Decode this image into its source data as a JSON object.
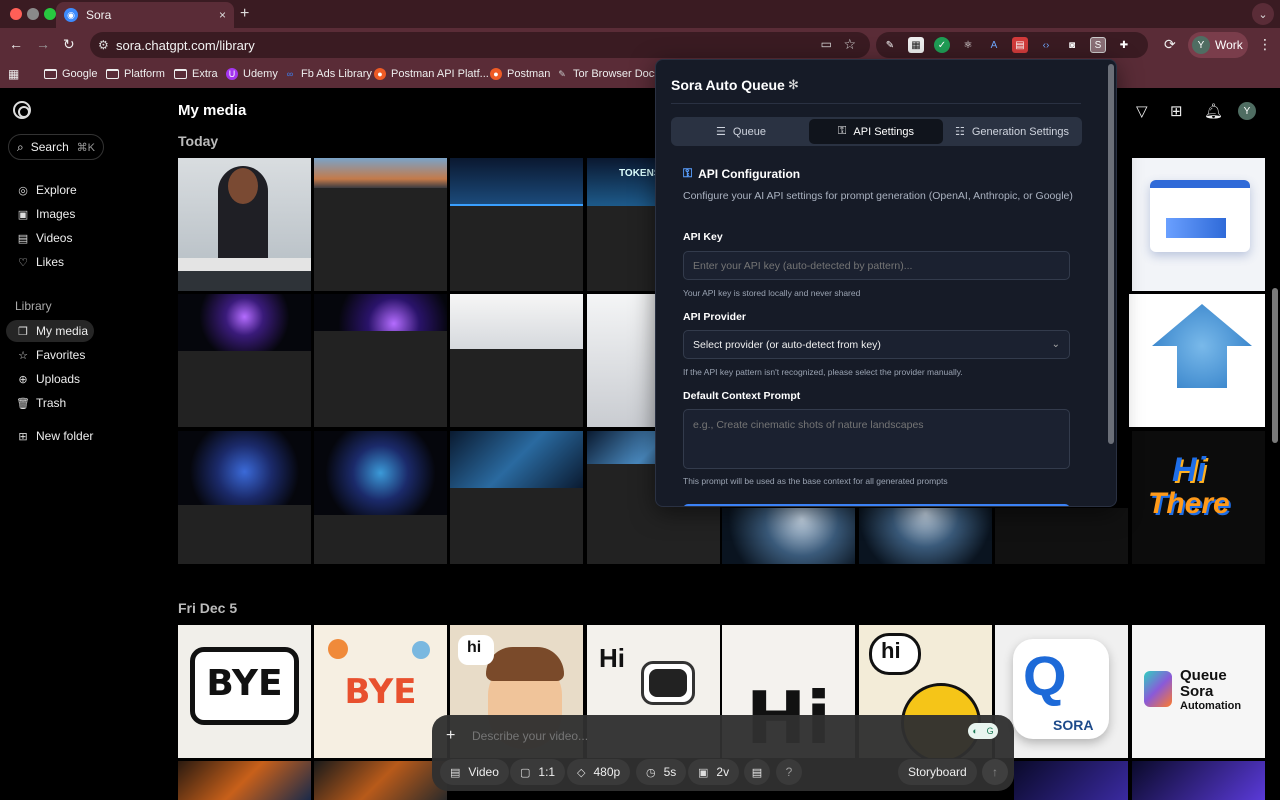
{
  "browser": {
    "tab_title": "Sora",
    "tab_close": "×",
    "new_tab": "+",
    "url": "sora.chatgpt.com/library",
    "profile_initial": "Y",
    "profile_name": "Work",
    "bookmarks": [
      "Google",
      "Platform",
      "Extra",
      "Udemy",
      "Fb Ads Library",
      "Postman API Platf...",
      "Postman",
      "Tor Browser Docs"
    ]
  },
  "sidebar": {
    "search_label": "Search",
    "search_shortcut": "⌘K",
    "nav": [
      "Explore",
      "Images",
      "Videos",
      "Likes"
    ],
    "library_heading": "Library",
    "library_items": [
      "My media",
      "Favorites",
      "Uploads",
      "Trash"
    ],
    "new_folder": "New folder"
  },
  "main": {
    "title": "My media",
    "section_today": "Today",
    "section_fri": "Fri Dec 5",
    "user_initial": "Y",
    "thumb_text": {
      "tokens": "TOKENS",
      "bye": "BYE",
      "bye_floral": "BYE",
      "hi_bubble": "hi",
      "hi_robot": "Hi",
      "hi_big": "Hi",
      "hi_smile": "hi",
      "q_letter": "Q",
      "sora": "SORA",
      "queue_line1": "Queue",
      "queue_line2": "Sora",
      "queue_line3": "Automation",
      "hi_there_1": "Hi",
      "hi_there_2": "There"
    }
  },
  "composer": {
    "placeholder": "Describe your video...",
    "type": "Video",
    "aspect": "1:1",
    "resolution": "480p",
    "duration": "5s",
    "variations": "2v",
    "help": "?",
    "storyboard": "Storyboard"
  },
  "panel": {
    "title": "Sora Auto Queue",
    "tabs": [
      "Queue",
      "API Settings",
      "Generation Settings"
    ],
    "active_tab": "API Settings",
    "section_title": "API Configuration",
    "section_desc": "Configure your AI API settings for prompt generation (OpenAI, Anthropic, or Google)",
    "api_key_label": "API Key",
    "api_key_placeholder": "Enter your API key (auto-detected by pattern)...",
    "api_key_help": "Your API key is stored locally and never shared",
    "provider_label": "API Provider",
    "provider_value": "Select provider (or auto-detect from key)",
    "provider_help": "If the API key pattern isn't recognized, please select the provider manually.",
    "context_label": "Default Context Prompt",
    "context_placeholder": "e.g., Create cinematic shots of nature landscapes",
    "context_help": "This prompt will be used as the base context for all generated prompts"
  },
  "colors": {
    "chrome_tab_bar": "#3a1b22",
    "chrome_toolbar": "#5a2c37",
    "panel_bg": "#161b27",
    "accent_blue": "#3b82f6"
  }
}
